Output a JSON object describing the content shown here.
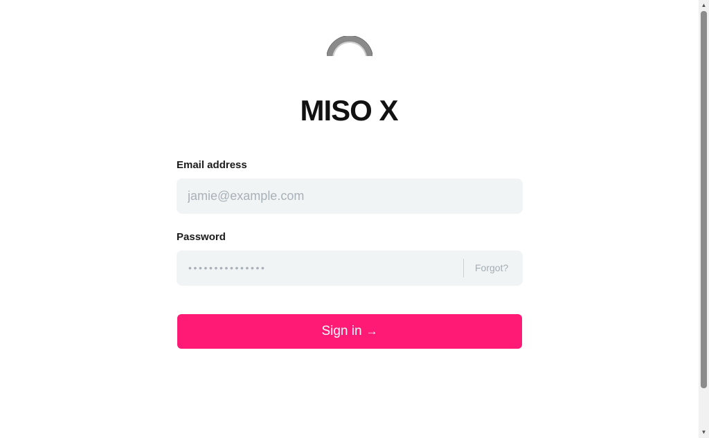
{
  "brand": {
    "title": "MISO X",
    "logo_icon": "ring-logo-icon"
  },
  "form": {
    "email_label": "Email address",
    "email_placeholder": "jamie@example.com",
    "email_value": "",
    "password_label": "Password",
    "password_masked": "•••••••••••••••",
    "forgot_label": "Forgot?",
    "submit_label": "Sign in",
    "submit_icon": "→"
  },
  "colors": {
    "accent": "#ff1a75",
    "field_bg": "#f1f4f5",
    "text": "#121212",
    "muted": "#a9b1b8"
  }
}
